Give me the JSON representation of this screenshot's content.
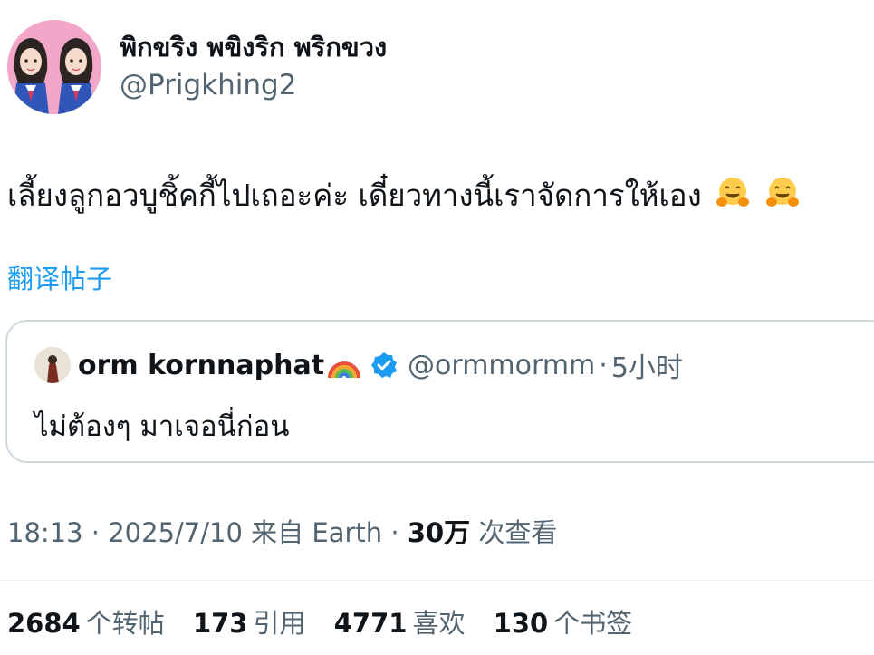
{
  "author": {
    "display_name": "พิกขริง พขิงริก พริกขวง",
    "handle": "@Prigkhing2",
    "avatar_icon": "profile-avatar"
  },
  "tweet": {
    "text": "เลี้ยงลูกอวบูชิ้คกี้ไปเถอะค่ะ เดี๋ยวทางนี้เราจัดการให้เอง",
    "emojis": [
      "hugging-face-emoji",
      "hugging-face-emoji"
    ],
    "translate_label": "翻译帖子"
  },
  "quote": {
    "name": "orm kornnaphat",
    "name_emoji": "rainbow-emoji",
    "verified": true,
    "handle": "@ormmormm",
    "separator": "·",
    "time": "5小时",
    "text": "ไม่ต้องๆ มาเจอนี่ก่อน"
  },
  "meta": {
    "time": "18:13",
    "sep1": " · ",
    "date": "2025/7/10",
    "source": " 来自 Earth",
    "sep2": " · ",
    "views_count": "30万",
    "views_label": " 次查看"
  },
  "stats": {
    "retweets": {
      "count": "2684",
      "label": "个转帖"
    },
    "quotes": {
      "count": "173",
      "label": "引用"
    },
    "likes": {
      "count": "4771",
      "label": "喜欢"
    },
    "bookmarks": {
      "count": "130",
      "label": "个书签"
    }
  },
  "colors": {
    "link_blue": "#1d9bf0",
    "secondary_text": "#536471",
    "border": "#cfd9de",
    "avatar_bg": "#f2a7c8"
  }
}
